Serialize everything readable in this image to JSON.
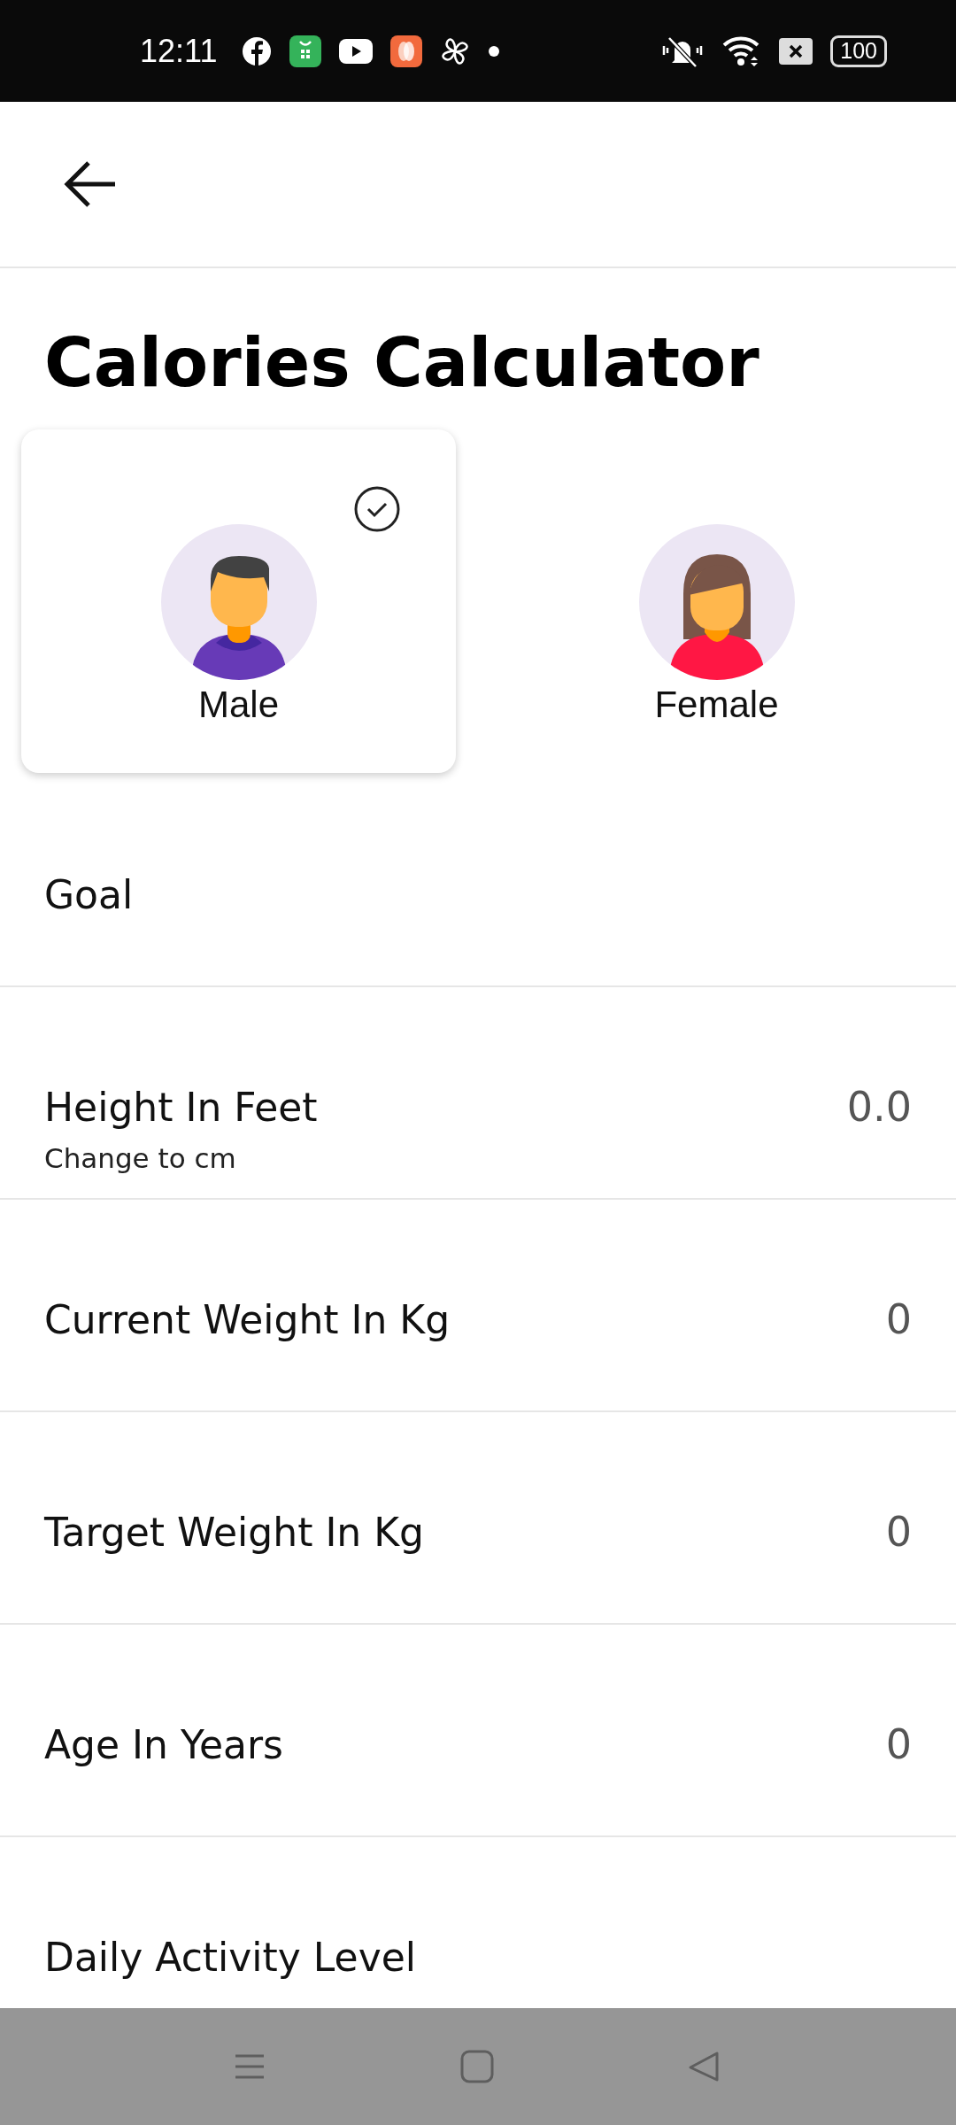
{
  "status_bar": {
    "time": "12:11",
    "battery": "100"
  },
  "title": "Calories Calculator",
  "genders": [
    {
      "label": "Male",
      "kind": "male",
      "selected": true
    },
    {
      "label": "Female",
      "kind": "female",
      "selected": false
    }
  ],
  "fields": [
    {
      "label": "Goal"
    },
    {
      "label": "Height In Feet",
      "value": "0.0",
      "link": "Change to cm"
    },
    {
      "label": "Current Weight In Kg",
      "value": "0"
    },
    {
      "label": "Target Weight In Kg",
      "value": "0"
    },
    {
      "label": "Age In Years",
      "value": "0"
    },
    {
      "label": "Daily Activity Level"
    }
  ]
}
